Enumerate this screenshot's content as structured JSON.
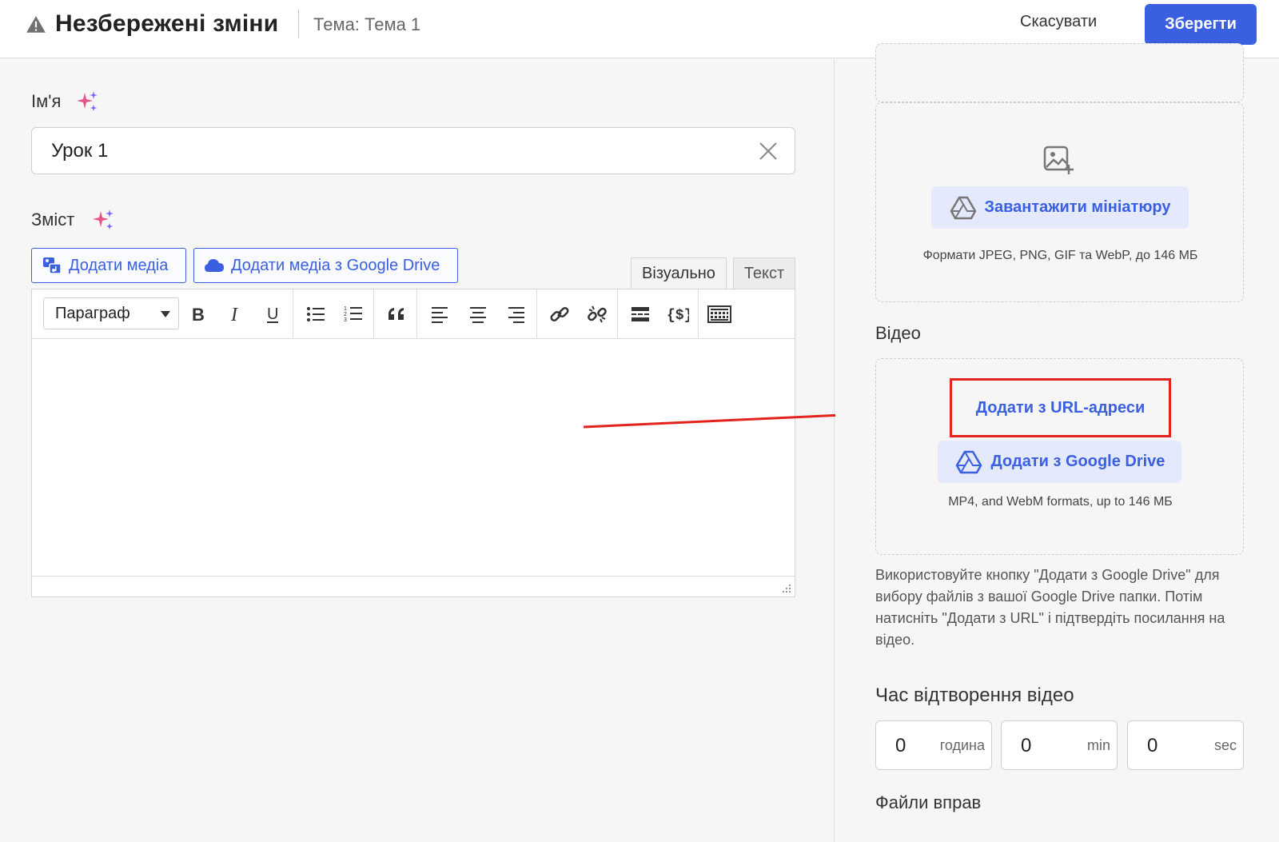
{
  "header": {
    "title": "Незбережені зміни",
    "topic": "Тема: Тема 1",
    "cancel_label": "Скасувати",
    "save_label": "Зберегти"
  },
  "form": {
    "name_label": "Ім'я",
    "name_value": "Урок 1",
    "content_label": "Зміст",
    "add_media_label": "Додати медіа",
    "add_gdrive_media_label": "Додати медіа з Google Drive",
    "tabs": [
      "Візуально",
      "Текст"
    ],
    "format_selected": "Параграф"
  },
  "sidebar": {
    "upload_thumb_label": "Завантажити мініатюру",
    "thumb_formats": "Формати JPEG, PNG, GIF та WebP, до 146 МБ",
    "video_label": "Відео",
    "add_url_label": "Додати з URL-адреси",
    "add_gdrive_video_label": "Додати з Google Drive",
    "video_formats": "MP4, and WebM formats, up to 146 МБ",
    "help_text": "Використовуйте кнопку \"Додати з Google Drive\" для вибору файлів з вашої Google Drive папки. Потім натисніть \"Додати з URL\" і підтвердіть посилання на відео.",
    "playtime_label": "Час відтворення відео",
    "time_fields": [
      {
        "value": "0",
        "unit": "година"
      },
      {
        "value": "0",
        "unit": "min"
      },
      {
        "value": "0",
        "unit": "sec"
      }
    ],
    "exercise_files_label": "Файли вправ"
  },
  "colors": {
    "accent": "#3a5fe0",
    "highlight": "#e3241c"
  },
  "icons": [
    "warning-icon",
    "sparkle-icon",
    "clear-icon",
    "media-icon",
    "cloud-icon",
    "bold-icon",
    "italic-icon",
    "underline-icon",
    "bullet-list-icon",
    "numbered-list-icon",
    "blockquote-icon",
    "align-left-icon",
    "align-center-icon",
    "align-right-icon",
    "link-icon",
    "unlink-icon",
    "read-more-icon",
    "code-icon",
    "keyboard-icon",
    "image-add-icon",
    "google-drive-icon"
  ]
}
